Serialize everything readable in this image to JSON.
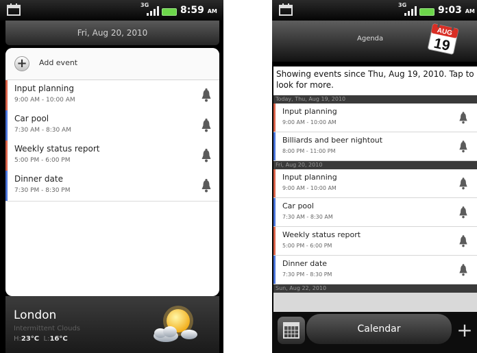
{
  "left": {
    "status": {
      "time": "8:59",
      "ampm": "AM",
      "net": "3G"
    },
    "date_header": "Fri, Aug 20, 2010",
    "add_event_label": "Add event",
    "events": [
      {
        "title": "Input planning",
        "time": "9:00 AM - 10:00 AM",
        "color": "#d9634a"
      },
      {
        "title": "Car pool",
        "time": "7:30 AM - 8:30 AM",
        "color": "#4a74d9"
      },
      {
        "title": "Weekly status report",
        "time": "5:00 PM - 6:00 PM",
        "color": "#d9634a"
      },
      {
        "title": "Dinner date",
        "time": "7:30 PM - 8:30 PM",
        "color": "#4a74d9"
      }
    ],
    "weather": {
      "city": "London",
      "condition": "Intermittent Clouds",
      "high_label": "H:",
      "high": "23°C",
      "low_label": "L:",
      "low": "16°C",
      "icon": "partly-sunny-icon"
    }
  },
  "right": {
    "status": {
      "time": "9:03",
      "ampm": "AM",
      "net": "3G"
    },
    "title": "Agenda",
    "calendar_icon": {
      "month": "AUG",
      "day": "19"
    },
    "note": "Showing events since Thu, Aug 19, 2010. Tap to look for more.",
    "sections": [
      {
        "label": "Today, Thu, Aug 19, 2010"
      },
      {
        "label": "Fri, Aug 20, 2010"
      },
      {
        "label": "Sun, Aug 22, 2010"
      }
    ],
    "events_today": [
      {
        "title": "Input planning",
        "time": "9:00 AM - 10:00 AM",
        "color": "#d9634a"
      },
      {
        "title": "Billiards and beer nightout",
        "time": "8:00 PM - 11:00 PM",
        "color": "#4a74d9"
      }
    ],
    "events_fri": [
      {
        "title": "Input planning",
        "time": "9:00 AM - 10:00 AM",
        "color": "#d9634a"
      },
      {
        "title": "Car pool",
        "time": "7:30 AM - 8:30 AM",
        "color": "#4a74d9"
      },
      {
        "title": "Weekly status report",
        "time": "5:00 PM - 6:00 PM",
        "color": "#d9634a"
      },
      {
        "title": "Dinner date",
        "time": "7:30 PM - 8:30 PM",
        "color": "#4a74d9"
      }
    ],
    "bottom_bar": {
      "label": "Calendar",
      "add_icon": "plus-icon",
      "calendar_icon": "calendar-grid-icon"
    }
  }
}
